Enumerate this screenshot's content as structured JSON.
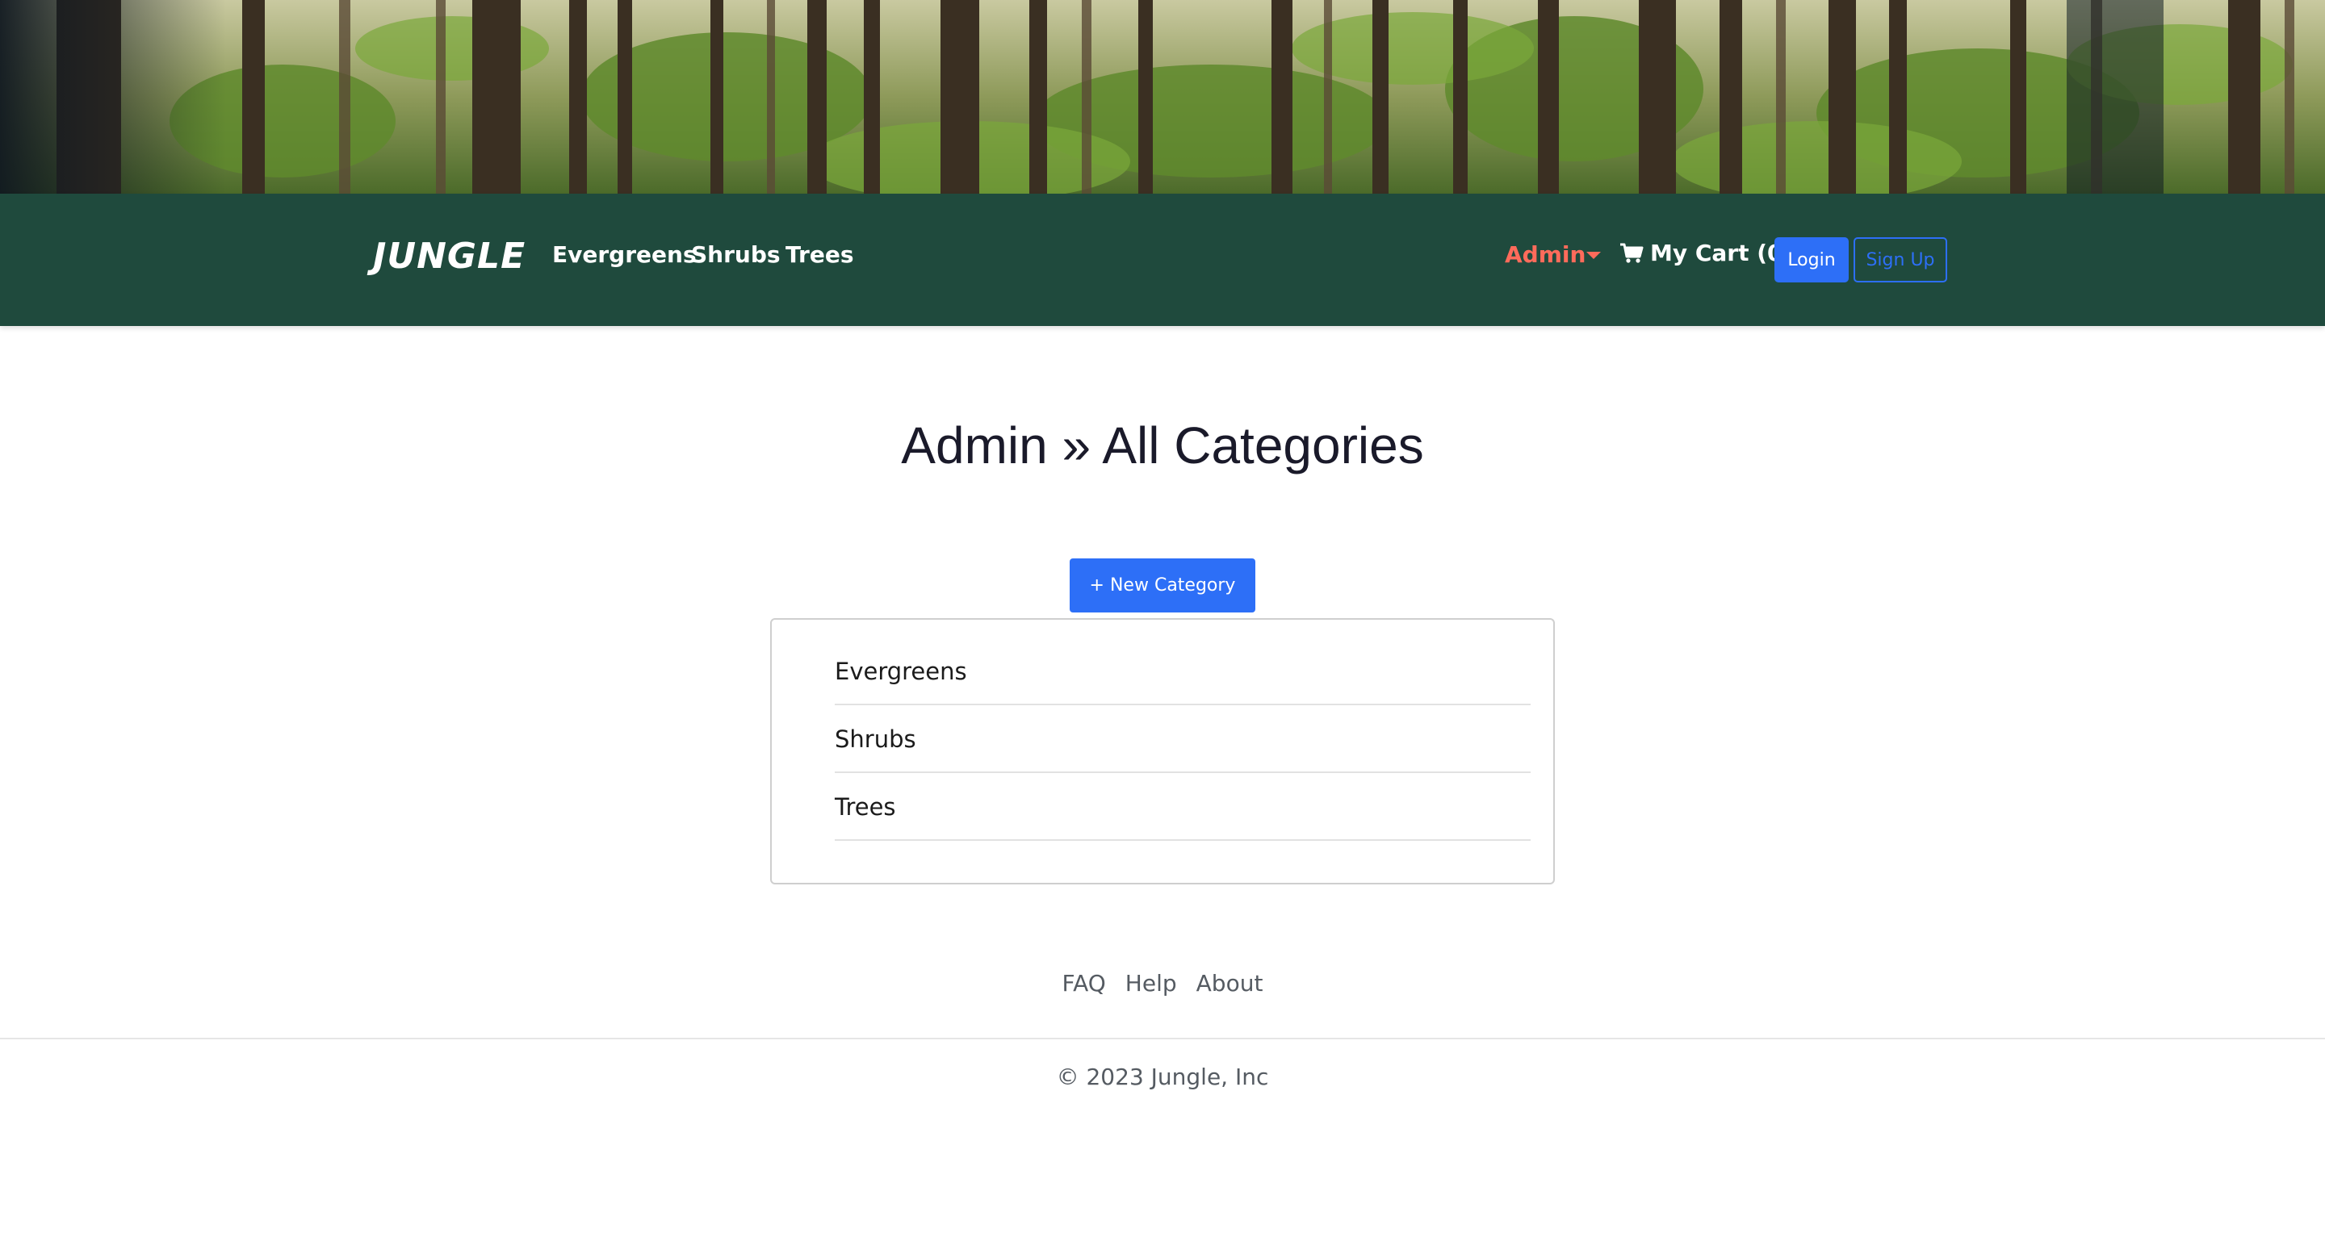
{
  "navbar": {
    "brand": "JUNGLE",
    "links": [
      "Evergreens",
      "Shrubs",
      "Trees"
    ],
    "admin_label": "Admin",
    "cart_label": "My Cart (0)",
    "login_label": "Login",
    "signup_label": "Sign Up"
  },
  "main": {
    "title": "Admin » All Categories",
    "new_button_label": "+ New Category",
    "categories": [
      "Evergreens",
      "Shrubs",
      "Trees"
    ]
  },
  "footer": {
    "links": [
      "FAQ",
      "Help",
      "About"
    ],
    "copyright": "© 2023 Jungle, Inc"
  },
  "icons": {
    "cart": "cart-icon",
    "caret": "chevron-down-icon"
  },
  "colors": {
    "navbar_bg": "#1f4a3d",
    "admin": "#ff6b5b",
    "primary": "#2d6ff7"
  }
}
